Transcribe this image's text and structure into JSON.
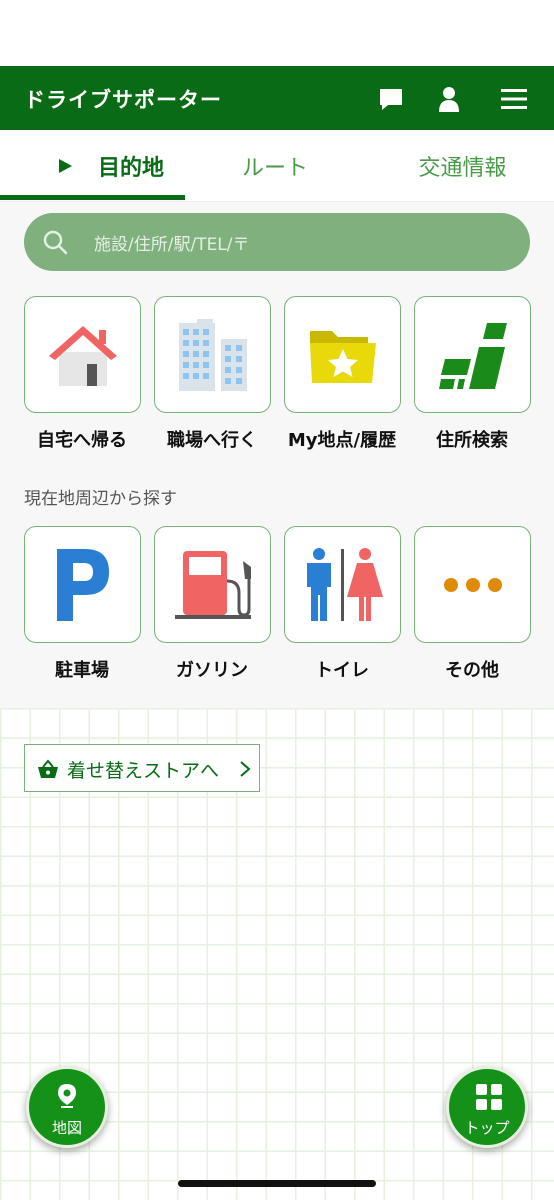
{
  "header": {
    "title": "ドライブサポーター",
    "icons": [
      "message-icon",
      "user-icon",
      "menu-icon"
    ]
  },
  "tabs": [
    {
      "label": "目的地",
      "active": true
    },
    {
      "label": "ルート",
      "active": false
    },
    {
      "label": "交通情報",
      "active": false
    }
  ],
  "search": {
    "placeholder": "施設/住所/駅/TEL/〒"
  },
  "shortcuts": [
    {
      "label": "自宅へ帰る",
      "icon": "house-icon"
    },
    {
      "label": "職場へ行く",
      "icon": "office-building-icon"
    },
    {
      "label": "My地点/履歴",
      "icon": "star-folder-icon"
    },
    {
      "label": "住所検索",
      "icon": "address-blocks-icon"
    }
  ],
  "nearby": {
    "label": "現在地周辺から探す",
    "items": [
      {
        "label": "駐車場",
        "icon": "parking-icon"
      },
      {
        "label": "ガソリン",
        "icon": "gas-pump-icon"
      },
      {
        "label": "トイレ",
        "icon": "restroom-icon"
      },
      {
        "label": "その他",
        "icon": "more-dots-icon"
      }
    ]
  },
  "store_button": {
    "label": "着せ替えストアへ"
  },
  "fab_left": {
    "label": "地図"
  },
  "fab_right": {
    "label": "トップ"
  },
  "colors": {
    "header_green": "#0a6b17",
    "search_green": "#7fb07e",
    "tile_border": "#7bb27a",
    "fab_green": "#159019"
  }
}
